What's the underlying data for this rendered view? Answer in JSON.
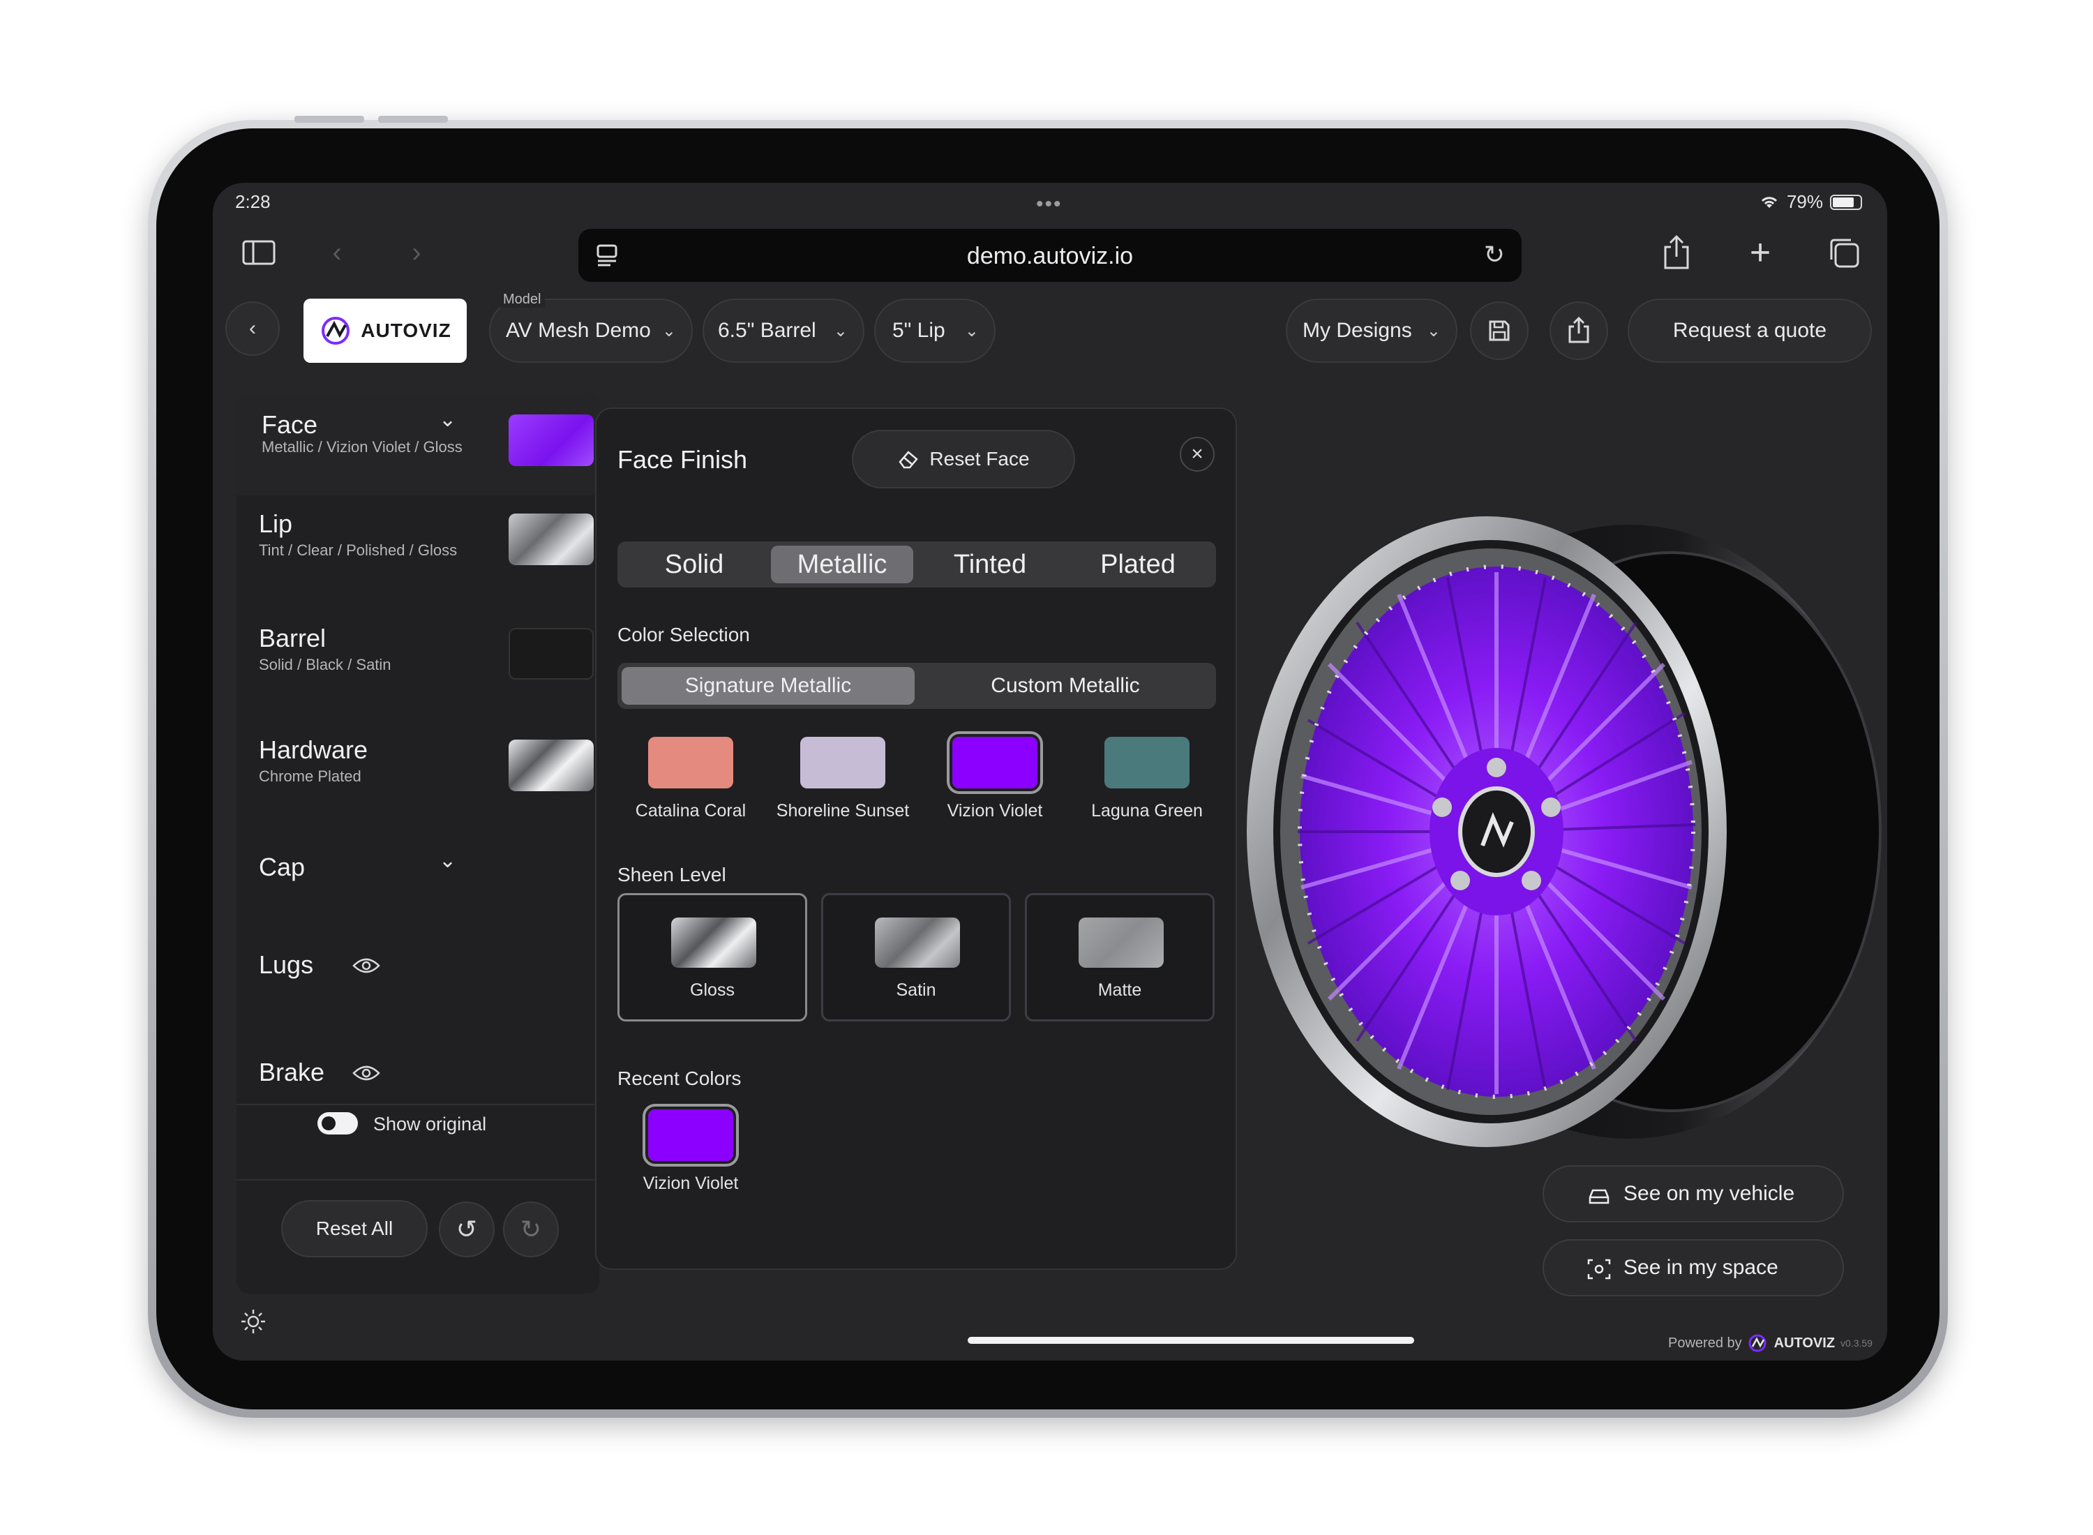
{
  "status_bar": {
    "time": "2:28",
    "battery": "79%"
  },
  "browser": {
    "url": "demo.autoviz.io"
  },
  "app_bar": {
    "logo_text": "AUTOVIZ",
    "model_label": "Model",
    "model_value": "AV Mesh Demo",
    "barrel_value": "6.5\" Barrel",
    "lip_value": "5\" Lip",
    "my_designs": "My Designs",
    "request_quote": "Request a quote"
  },
  "parts": [
    {
      "name": "Face",
      "sub": "Metallic / Vizion Violet / Gloss"
    },
    {
      "name": "Lip",
      "sub": "Tint / Clear / Polished / Gloss"
    },
    {
      "name": "Barrel",
      "sub": "Solid / Black / Satin"
    },
    {
      "name": "Hardware",
      "sub": "Chrome Plated"
    },
    {
      "name": "Cap",
      "sub": ""
    },
    {
      "name": "Lugs",
      "sub": ""
    },
    {
      "name": "Brake",
      "sub": ""
    }
  ],
  "left_footer": {
    "show_original": "Show original",
    "reset_all": "Reset All"
  },
  "finish_panel": {
    "title": "Face Finish",
    "reset_label": "Reset Face",
    "finish_types": [
      "Solid",
      "Metallic",
      "Tinted",
      "Plated"
    ],
    "active_finish_type": "Metallic",
    "color_selection_label": "Color Selection",
    "color_tabs": [
      "Signature Metallic",
      "Custom Metallic"
    ],
    "active_color_tab": "Signature Metallic",
    "swatches": [
      {
        "name": "Catalina Coral",
        "color": "#e58a7e"
      },
      {
        "name": "Shoreline Sunset",
        "color": "#c7bcd6"
      },
      {
        "name": "Vizion Violet",
        "color": "#8b00ff"
      },
      {
        "name": "Laguna Green",
        "color": "#4a7a7c"
      }
    ],
    "selected_swatch": "Vizion Violet",
    "sheen_label": "Sheen Level",
    "sheens": [
      "Gloss",
      "Satin",
      "Matte"
    ],
    "active_sheen": "Gloss",
    "recent_label": "Recent Colors",
    "recent": [
      {
        "name": "Vizion Violet",
        "color": "#8b00ff"
      }
    ]
  },
  "viewer": {
    "see_on_vehicle": "See on my vehicle",
    "see_in_space": "See in my space",
    "powered_by": "Powered by",
    "powered_brand": "AUTOVIZ",
    "version": "v0.3.59"
  },
  "colors": {
    "accent_violet": "#8b00ff",
    "app_bg": "#262628"
  }
}
